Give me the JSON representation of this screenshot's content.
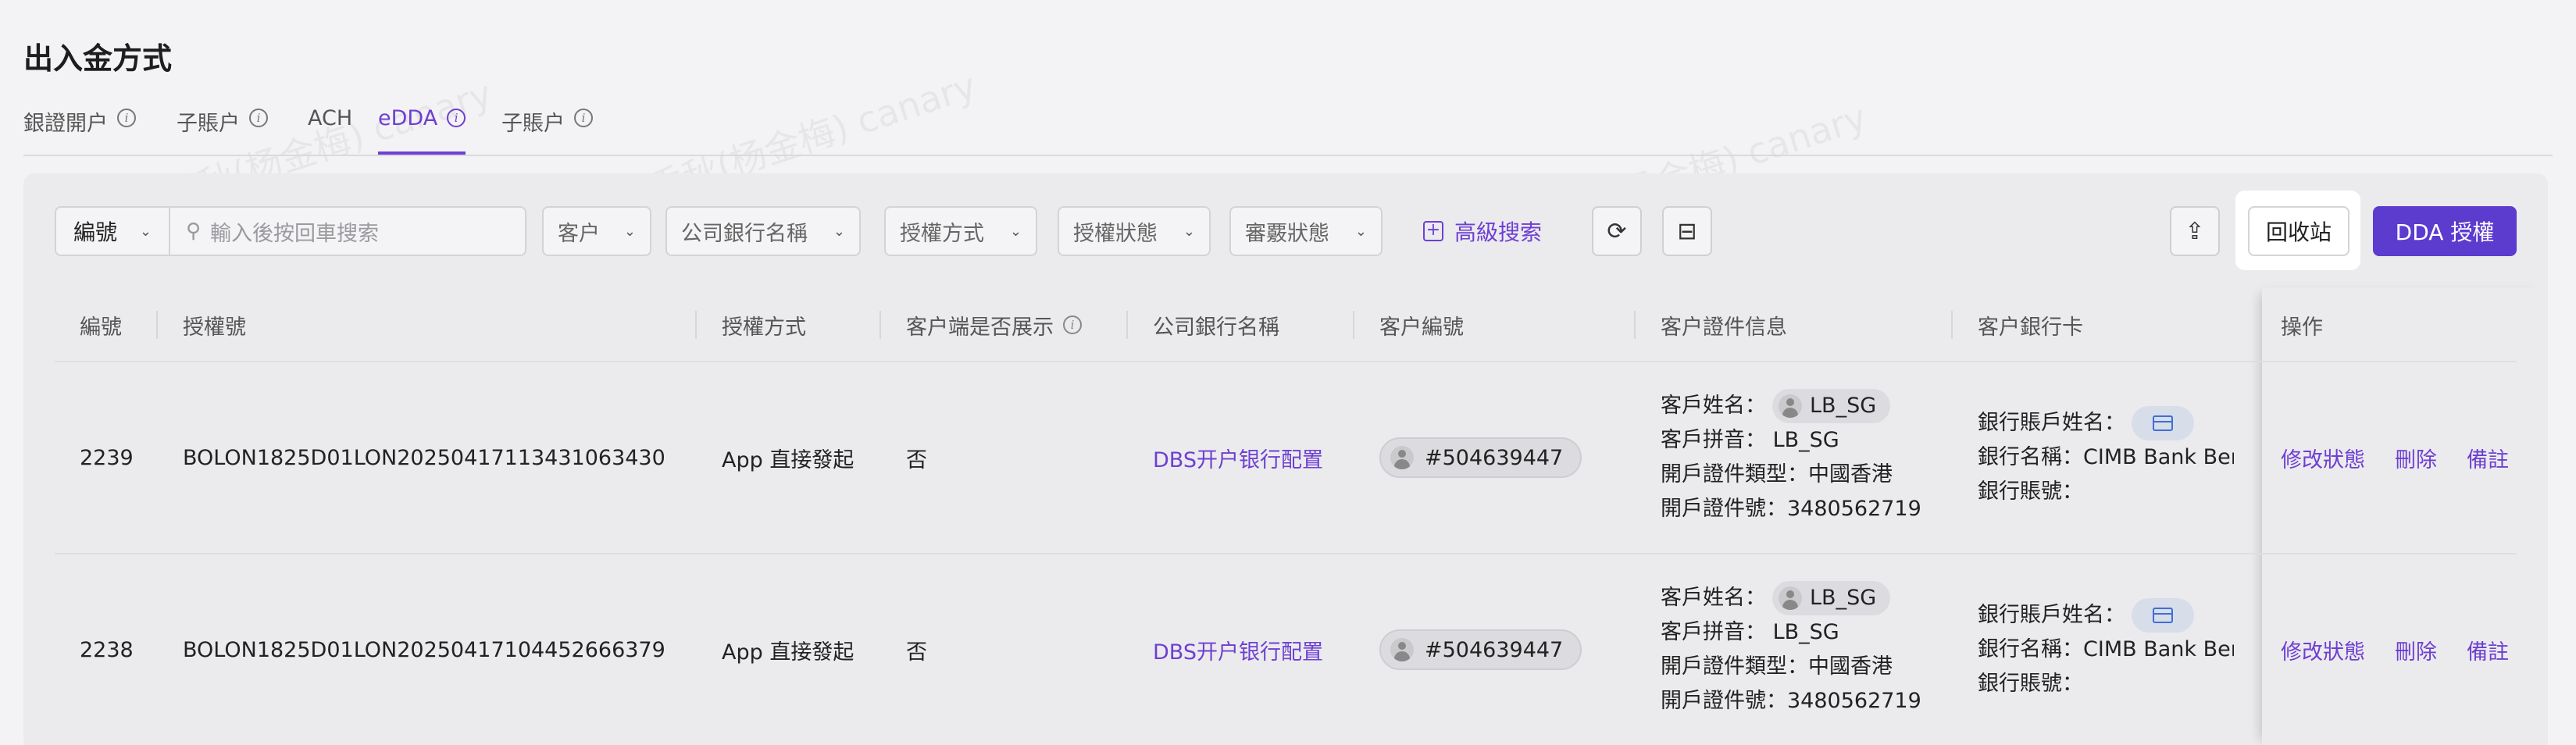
{
  "page": {
    "title": "出入金方式"
  },
  "tabs": [
    {
      "label": "銀證開户",
      "info": true
    },
    {
      "label": "子賬户",
      "info": true
    },
    {
      "label": "ACH",
      "info": false
    },
    {
      "label": "eDDA",
      "info": true,
      "active": true
    },
    {
      "label": "子賬户",
      "info": true
    }
  ],
  "toolbar": {
    "search_prefix": "編號",
    "search_placeholder": "輸入後按回車搜索",
    "filters": [
      "客户",
      "公司銀行名稱",
      "授權方式",
      "授權狀態",
      "審覈狀態"
    ],
    "advanced_search": "高級搜索",
    "recycle_bin": "回收站",
    "dda_button": "DDA 授權"
  },
  "table": {
    "columns": [
      "編號",
      "授權號",
      "授權方式",
      "客户端是否展示",
      "公司銀行名稱",
      "客户編號",
      "客户證件信息",
      "客户銀行卡",
      "操作"
    ],
    "labels": {
      "name": "客戶姓名：",
      "pinyin": "客戶拼音：",
      "id_type": "開戶證件類型：",
      "id_no": "開戶證件號：",
      "acct_name": "銀行賬戶姓名：",
      "bank_name": "銀行名稱：",
      "acct_no": "銀行賬號："
    },
    "rows": [
      {
        "id": "2239",
        "auth_no": "BOLON1825D01LON20250417113431063430",
        "auth_method": "App 直接發起",
        "client_display": "否",
        "company_bank": "DBS开户银行配置",
        "customer_no": "#504639447",
        "name": "LB_SG",
        "pinyin": "LB_SG",
        "id_type": "中國香港",
        "id_no": "3480562719",
        "bank_name": "CIMB Bank Ber",
        "actions": [
          "修改狀態",
          "刪除",
          "備註"
        ]
      },
      {
        "id": "2238",
        "auth_no": "BOLON1825D01LON20250417104452666379",
        "auth_method": "App 直接發起",
        "client_display": "否",
        "company_bank": "DBS开户银行配置",
        "customer_no": "#504639447",
        "name": "LB_SG",
        "pinyin": "LB_SG",
        "id_type": "中國香港",
        "id_no": "3480562719",
        "bank_name": "CIMB Bank Ber",
        "actions": [
          "修改狀態",
          "刪除",
          "備註"
        ]
      }
    ]
  },
  "watermark": "秀秋(杨金梅) canary",
  "colors": {
    "accent": "#6e3fd1",
    "primary_button": "#5c3bcf",
    "panel": "#ebebee"
  }
}
